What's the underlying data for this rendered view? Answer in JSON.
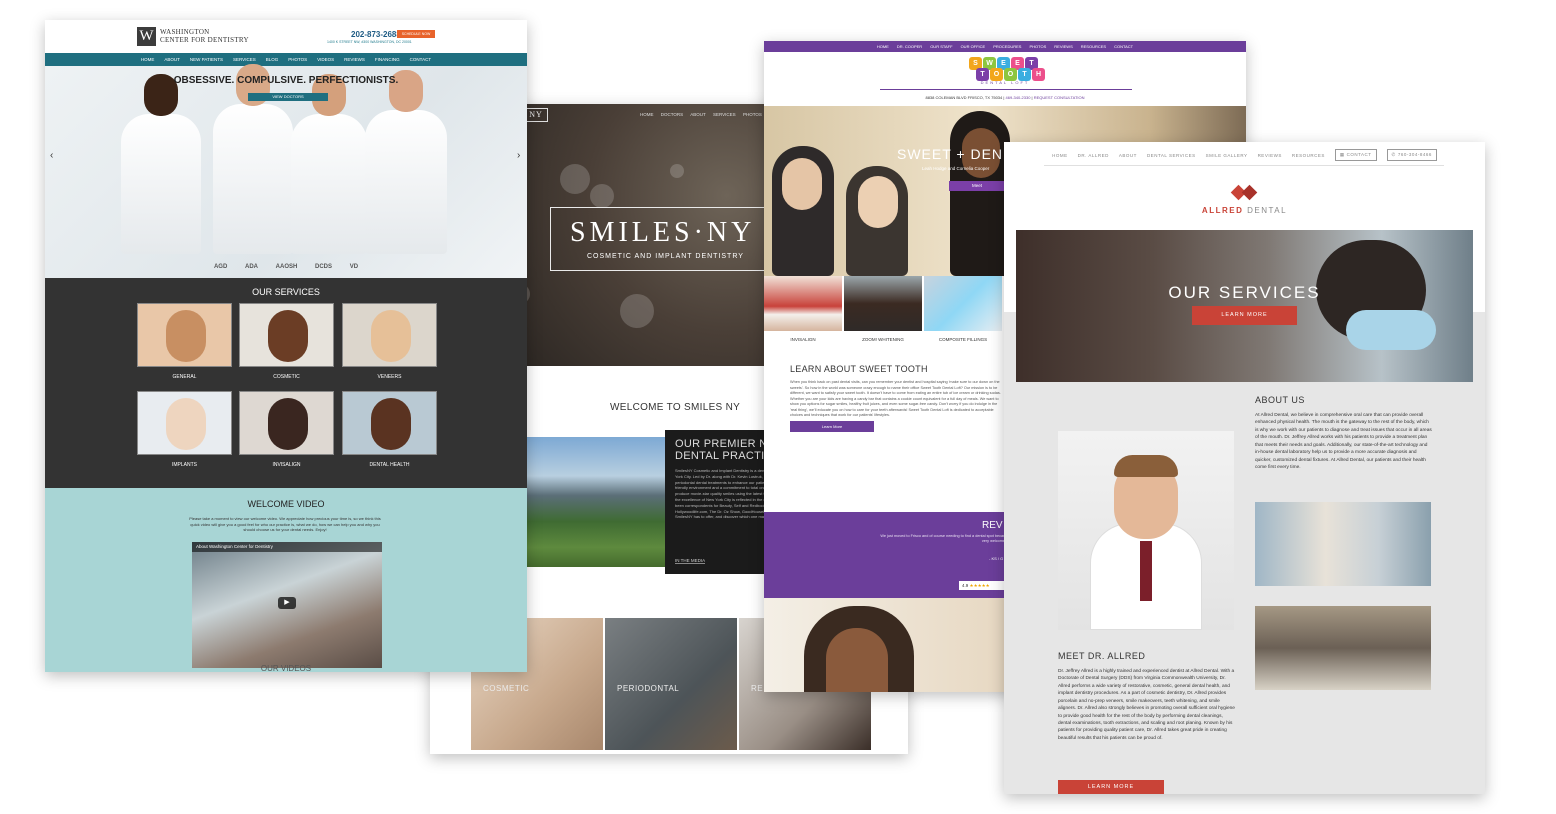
{
  "washington": {
    "logo_line1": "WASHINGTON",
    "logo_line2": "CENTER FOR DENTISTRY",
    "phone": "202-873-2688",
    "schedule_label": "SCHEDULE NOW",
    "address": "1400 K STREET NW, #300 WASHINGTON, DC 20001",
    "nav": [
      "HOME",
      "ABOUT",
      "NEW PATIENTS",
      "SERVICES",
      "BLOG",
      "PHOTOS",
      "VIDEOS",
      "REVIEWS",
      "FINANCING",
      "CONTACT"
    ],
    "tagline": "OBSESSIVE. COMPULSIVE. PERFECTIONISTS.",
    "doctors_button": "VIEW DOCTORS",
    "services_heading": "OUR SERVICES",
    "services": [
      "GENERAL",
      "COSMETIC",
      "VENEERS",
      "IMPLANTS",
      "INVISALIGN",
      "DENTAL HEALTH"
    ],
    "welcome_heading": "WELCOME VIDEO",
    "welcome_text": "Please take a moment to view our welcome video. We appreciate how precious your time is, so we think this quick video will give you a good feel for who our practice is, what we do, how we can help you and why you should choose us for your dental needs. Enjoy!",
    "video_title": "About Washington Center for Dentistry",
    "our_videos": "OUR VIDEOS"
  },
  "smiles": {
    "nav": [
      "HOME",
      "DOCTORS",
      "ABOUT",
      "SERVICES",
      "PHOTOS",
      "REV"
    ],
    "logo": "SMILES·NY",
    "logo_sub": "COSMETIC AND IMPLANT DENTISTRY",
    "welcome": "WELCOME TO SMILES NY",
    "premier_line1": "OUR PREMIER NEW",
    "premier_line2": "DENTAL PRACTICE",
    "premier_text": "SmilesNY Cosmetic and Implant Dentistry is a dental practice located in the heart of New York City. Led by Dr. along with Dr. Kevin Lostruk, our practice provides cosmetic and periodontal dental treatments to enhance our patients' smiles. SmilesNY has a patient-friendly environment and a commitment to total oral health. At our practice, our doctors produce movie-star quality smiles using the latest techniques. Their rigorous dedication to the excellence of New York City is reflected in the quality care and dental physicians have been correspondents for Beauty, Self and Redbook. Additionally, our practice Hollywoodlife.com, The Dr. Oz Show, GoodHousekeeping. To learn more about what SmilesNY has to offer, and discover which one may be right for you.",
    "media": "IN THE MEDIA",
    "photos": [
      "COSMETIC",
      "PERIODONTAL",
      "RE"
    ]
  },
  "sweet": {
    "nav": [
      "HOME",
      "DR. COOPER",
      "OUR STAFF",
      "OUR OFFICE",
      "PROCEDURES",
      "PHOTOS",
      "REVIEWS",
      "RESOURCES",
      "CONTACT"
    ],
    "logo_row1": [
      "S",
      "W",
      "E",
      "E",
      "T"
    ],
    "logo_row2": [
      "T",
      "O",
      "O",
      "T",
      "H"
    ],
    "dental": "DENTAL LOFT",
    "address": "8838 COLEMAN BLVD FRISCO, TX 75034",
    "phone": "469-340-2330",
    "request": "REQUEST CONSULTATION",
    "hero_title": "SWEET + DEN",
    "hero_sub": "Leah Hodge and Cornelia Cooper",
    "hero_btn": "Meet",
    "tiles": [
      "INVISALIGN",
      "ZOOM! WHITENING",
      "COMPOSITE FILLINGS"
    ],
    "learn_heading": "LEARN ABOUT SWEET TOOTH",
    "learn_text": "When you think back on past dental visits, can you remember your dentist and hospital saying 'make sure to our down on the sweets'. So how in the world was someone crazy enough to name their office Sweet Tooth Dental Loft? Our mission is to be different, we want to satisfy your sweet tooth. It doesn't have to come from eating an entire tub of ice cream or drinking sodas. Whether you are your kids are having a candy bar that contains a cookie count equivalent for a full day of meals. We want to show you options for sugar smiles, healthy fruit juices, and even some sugar-free candy. Don't worry if you do indulge in the 'real thing', we'll educate you on how to care for your teeth afterwards! Sweet Tooth Dental Loft is dedicated to acceptable choices and techniques that work for our patients' lifestyles.",
    "learn_btn": "Learn More",
    "reviews_heading": "REV",
    "review_quote": "We just moved to Frisco and of course needing to find a dental spot became really important. They are super friendly and made me feel very welcome.",
    "review_author": "- KS / G",
    "rating_value": "4.9",
    "rating_stars": "★★★★★"
  },
  "allred": {
    "nav": [
      "HOME",
      "DR. ALLRED",
      "ABOUT",
      "DENTAL SERVICES",
      "SMILE GALLERY",
      "REVIEWS",
      "RESOURCES"
    ],
    "contact": "CONTACT",
    "phone": "760-304-8466",
    "brand_red": "ALLRED",
    "brand_gray": " DENTAL",
    "hero_title": "OUR SERVICES",
    "hero_btn": "LEARN MORE",
    "about_heading": "ABOUT US",
    "about_text": "At Allred Dental, we believe in comprehensive oral care that can provide overall enhanced physical health. The mouth is the gateway to the rest of the body, which is why we work with our patients to diagnose and treat issues that occur in all areas of the mouth. Dr. Jeffrey Allred works with his patients to provide a treatment plan that meets their needs and goals. Additionally, our state-of-the-art technology and in-house dental laboratory help us to provide a more accurate diagnosis and quicker, customized dental fixtures. At Allred Dental, our patients and their health come first every time.",
    "meet_heading": "MEET DR. ALLRED",
    "meet_text": "Dr. Jeffrey Allred is a highly trained and experienced dentist at Allred Dental. With a Doctorate of Dental Surgery (DDS) from Virginia Commonwealth University, Dr. Allred performs a wide variety of restorative, cosmetic, general dental health, and implant dentistry procedures. As a part of cosmetic dentistry, Dr. Allred provides porcelain and no-prep veneers, smile makeovers, teeth whitening, and smile aligners. Dr. Allred also strongly believes in promoting overall sufficient oral hygiene to provide good health for the rest of the body by performing dental cleanings, dental examinations, tooth extractions, and scaling and root planing. Known by his patients for providing quality patient care, Dr. Allred takes great pride in creating beautiful results that his patients can be proud of.",
    "learn_btn": "LEARN MORE"
  },
  "colors": {
    "washington_teal": "#1f6f80",
    "washington_orange": "#e8632b",
    "sweet_purple": "#6b3e9a",
    "allred_red": "#c94337"
  }
}
